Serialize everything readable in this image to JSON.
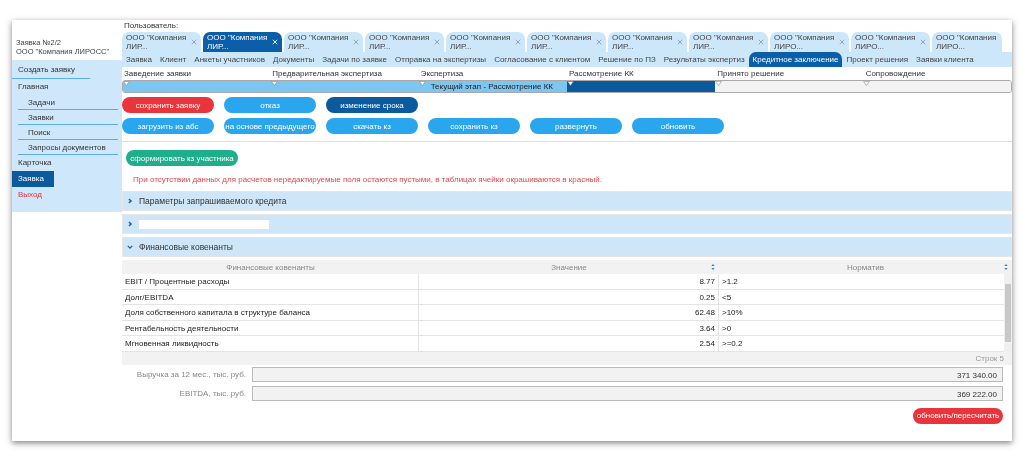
{
  "user_label": "Пользователь:",
  "sidebar": {
    "title": "Заявка №2/2",
    "subtitle": "ООО \"Компания ЛИРОСС\"",
    "items": [
      {
        "label": "Создать заявку",
        "kind": "action",
        "selected": false
      },
      {
        "label": "Главная",
        "kind": "group",
        "selected": false,
        "children": [
          {
            "label": "Задачи",
            "selected": false
          },
          {
            "label": "Заявки",
            "selected": false
          },
          {
            "label": "Поиск",
            "selected": false
          },
          {
            "label": "Запросы документов",
            "selected": false
          }
        ]
      },
      {
        "label": "Карточка",
        "kind": "group",
        "selected": false
      },
      {
        "label": "Заявка",
        "kind": "group",
        "selected": true
      },
      {
        "label": "Выход",
        "kind": "exit",
        "selected": false
      }
    ]
  },
  "document_tabs": [
    {
      "label": "ООО \"Компания ЛИР...",
      "selected": false,
      "closable": true
    },
    {
      "label": "ООО \"Компания ЛИР...",
      "selected": true,
      "closable": true
    },
    {
      "label": "ООО \"Компания ЛИР...",
      "selected": false,
      "closable": true
    },
    {
      "label": "ООО \"Компания ЛИР...",
      "selected": false,
      "closable": true
    },
    {
      "label": "ООО \"Компания ЛИР...",
      "selected": false,
      "closable": true
    },
    {
      "label": "ООО \"Компания ЛИР...",
      "selected": false,
      "closable": true
    },
    {
      "label": "ООО \"Компания ЛИР...",
      "selected": false,
      "closable": true
    },
    {
      "label": "ООО \"Компания ЛИР...",
      "selected": false,
      "closable": true
    },
    {
      "label": "ООО \"Компания ЛИРО...",
      "selected": false,
      "closable": true
    },
    {
      "label": "ООО \"Компания ЛИРО...",
      "selected": false,
      "closable": true
    },
    {
      "label": "ООО \"Компания ЛИРО...",
      "selected": false,
      "closable": false
    }
  ],
  "section_tabs": [
    {
      "label": "Заявка",
      "selected": false
    },
    {
      "label": "Клиент",
      "selected": false
    },
    {
      "label": "Анкеты участников",
      "selected": false
    },
    {
      "label": "Документы",
      "selected": false
    },
    {
      "label": "Задачи по заявке",
      "selected": false
    },
    {
      "label": "Отправка на экспертизы",
      "selected": false
    },
    {
      "label": "Согласование с клиентом",
      "selected": false
    },
    {
      "label": "Решение по ПЗ",
      "selected": false
    },
    {
      "label": "Результаты экспертиз",
      "selected": false
    },
    {
      "label": "Кредитное заключение",
      "selected": true
    },
    {
      "label": "Проект решения",
      "selected": false
    },
    {
      "label": "Заявки клиента",
      "selected": false
    }
  ],
  "stages": [
    {
      "label": "Заведение заявки",
      "done": true,
      "current": false
    },
    {
      "label": "Предварительная экспертиза",
      "done": true,
      "current": false
    },
    {
      "label": "Экспертиза",
      "done": true,
      "current": false
    },
    {
      "label": "Рассмотрение КК",
      "done": false,
      "current": true
    },
    {
      "label": "Принято решение",
      "done": false,
      "current": false
    },
    {
      "label": "Сопровождение",
      "done": false,
      "current": false
    }
  ],
  "progress_label": "Текущий этап - Рассмотрение КК",
  "button_rows": [
    [
      {
        "label": "сохранить заявку",
        "kind": "danger"
      },
      {
        "label": "отказ",
        "kind": "secondary"
      },
      {
        "label": "изменение срока",
        "kind": "primary"
      }
    ],
    [
      {
        "label": "загрузить из абс",
        "kind": "secondary"
      },
      {
        "label": "на основе предыдущего",
        "kind": "secondary"
      },
      {
        "label": "скачать кз",
        "kind": "secondary"
      },
      {
        "label": "сохранить кз",
        "kind": "secondary"
      },
      {
        "label": "развернуть",
        "kind": "secondary"
      },
      {
        "label": "обновить",
        "kind": "secondary"
      }
    ]
  ],
  "form_button": "сформировать кз участника",
  "notice": "При отсутствии данных для расчетов нередактируемые поля остаются пустыми, в таблицах ячейки окрашиваются в красный.",
  "panels": [
    {
      "kind": "title",
      "title": "Параметры запрашиваемого кредита",
      "expanded": false
    },
    {
      "kind": "input",
      "expanded": false
    },
    {
      "kind": "title",
      "title": "Финансовые ковенанты",
      "expanded": true
    }
  ],
  "table": {
    "columns": [
      {
        "label": "Финансовые ковенанты",
        "sortable": false
      },
      {
        "label": "Значение",
        "sortable": true
      },
      {
        "label": "Норматив",
        "sortable": true
      }
    ],
    "rows": [
      {
        "name": "EBIT / Процентные расходы",
        "value": "8.77",
        "norm": ">1.2"
      },
      {
        "name": "Долг/EBITDA",
        "value": "0.25",
        "norm": "<5"
      },
      {
        "name": "Доля собственного капитала в структуре баланса",
        "value": "62.48",
        "norm": ">10%"
      },
      {
        "name": "Рентабельность деятельности",
        "value": "3.64",
        "norm": ">0"
      },
      {
        "name": "Мгновенная ликвидность",
        "value": "2.54",
        "norm": ">=0.2"
      }
    ],
    "footer": "Строк 5"
  },
  "fields": [
    {
      "label": "Выручка за 12 мес., тыс. руб.",
      "value": "371 340.00"
    },
    {
      "label": "EBITDA, тыс. руб.",
      "value": "369 222.00"
    }
  ],
  "recalc_button": "обновить/пересчитать"
}
